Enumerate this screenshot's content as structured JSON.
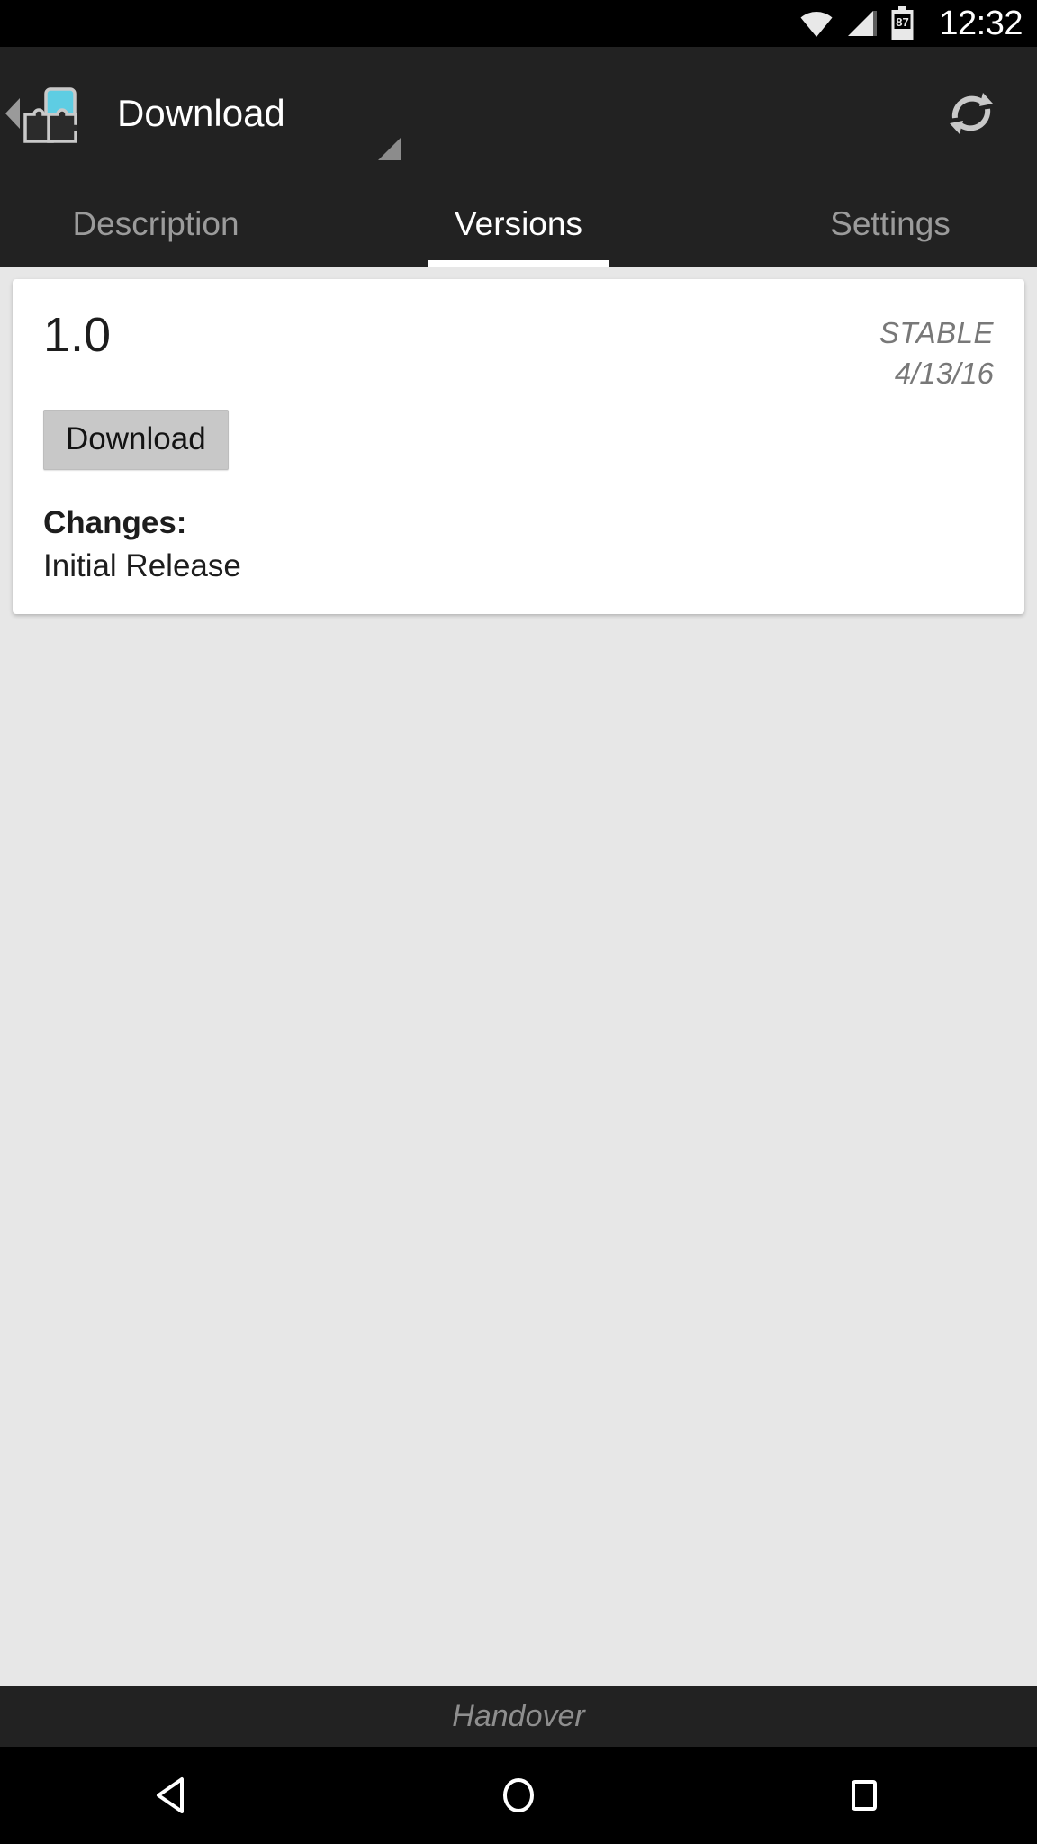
{
  "statusbar": {
    "clock": "12:32",
    "battery_level": "87",
    "icons": [
      "wifi-icon",
      "cell-signal-icon",
      "battery-icon"
    ]
  },
  "actionbar": {
    "title": "Download",
    "app_icon": "puzzle-phone-app-icon",
    "up_icon": "back-caret-icon",
    "spinner_icon": "dropdown-triangle-icon",
    "refresh_label": "refresh-icon",
    "accent_color": "#5ecde3",
    "background_color": "#222222"
  },
  "tabs": [
    {
      "label": "Description",
      "active": false
    },
    {
      "label": "Versions",
      "active": true
    },
    {
      "label": "Settings",
      "active": false
    }
  ],
  "versions": [
    {
      "version": "1.0",
      "channel": "STABLE",
      "date": "4/13/16",
      "download_label": "Download",
      "changes_label": "Changes:",
      "changes_text": "Initial Release"
    }
  ],
  "footer": {
    "text": "Handover"
  },
  "navbar": {
    "back": "back-triangle-icon",
    "home": "home-circle-icon",
    "recents": "recents-square-icon"
  }
}
